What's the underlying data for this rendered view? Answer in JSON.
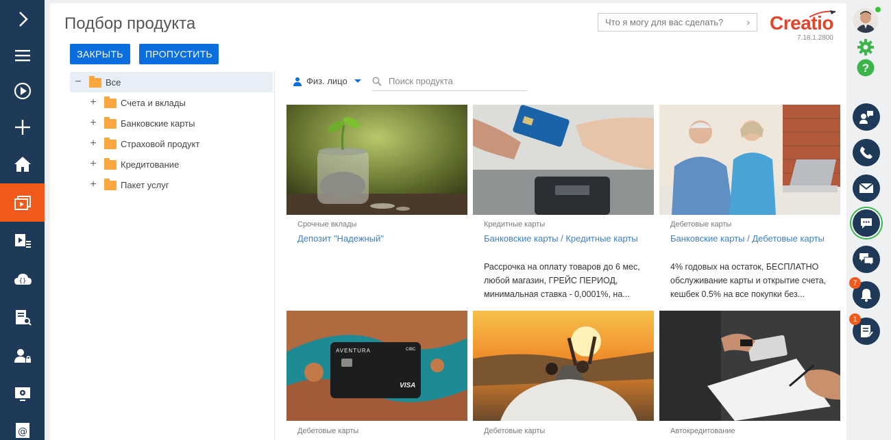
{
  "header": {
    "title": "Подбор продукта",
    "close_label": "ЗАКРЫТЬ",
    "skip_label": "ПРОПУСТИТЬ",
    "command_placeholder": "Что я могу для вас сделать?",
    "logo_text": "Creatio",
    "version": "7.18.1.2800"
  },
  "tree": {
    "root": "Все",
    "items": [
      {
        "label": "Счета и вклады"
      },
      {
        "label": "Банковские карты"
      },
      {
        "label": "Страховой продукт"
      },
      {
        "label": "Кредитование"
      },
      {
        "label": "Пакет услуг"
      }
    ]
  },
  "filter": {
    "client_type": "Физ. лицо",
    "search_placeholder": "Поиск продукта"
  },
  "products": [
    {
      "category": "Срочные вклады",
      "name": "Депозит \"Надежный\"",
      "description": ""
    },
    {
      "category": "Кредитные карты",
      "name": "Банковские карты / Кредитные карты",
      "description": "Рассрочка на оплату товаров до 6 мес, любой магазин, ГРЕЙС ПЕРИОД, минимальная ставка - 0,0001%, на..."
    },
    {
      "category": "Дебетовые карты",
      "name": "Банковские карты / Дебетовые карты",
      "description": "4% годовых на остаток, БЕСПЛАТНО обслуживание карты и открытие счета, кешбек 0.5% на все покупки без..."
    },
    {
      "category": "Дебетовые карты",
      "name": "",
      "description": "",
      "card_brand": "AVENTURA",
      "card_bank": "CIBC",
      "card_network": "VISA"
    },
    {
      "category": "Дебетовые карты",
      "name": "",
      "description": ""
    },
    {
      "category": "Автокредитование",
      "name": "",
      "description": ""
    }
  ],
  "rightbar": {
    "notifications_count": "7",
    "tasks_count": "1"
  },
  "colors": {
    "nav_bg": "#1f3a58",
    "nav_active": "#f25a1c",
    "primary_button": "#0a6ede",
    "link": "#3f7fc7",
    "badge": "#f25a1c",
    "online": "#33c63a"
  }
}
